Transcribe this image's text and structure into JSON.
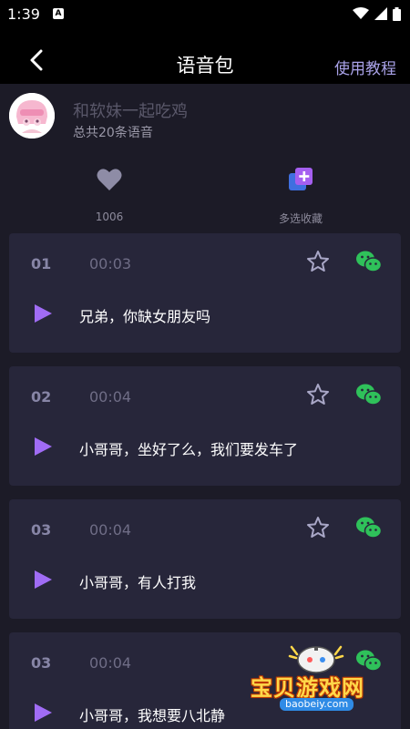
{
  "status_bar": {
    "time": "1:39",
    "notification_letter": "A"
  },
  "header": {
    "title": "语音包",
    "tutorial_label": "使用教程"
  },
  "profile": {
    "name": "和软妹一起吃鸡",
    "count_text": "总共20条语音"
  },
  "actions": {
    "like_count": "1006",
    "multi_select_label": "多选收藏"
  },
  "clips": [
    {
      "index": "01",
      "duration": "00:03",
      "text": "兄弟，你缺女朋友吗"
    },
    {
      "index": "02",
      "duration": "00:04",
      "text": "小哥哥，坐好了么，我们要发车了"
    },
    {
      "index": "03",
      "duration": "00:04",
      "text": "小哥哥，有人打我"
    },
    {
      "index": "03",
      "duration": "00:04",
      "text": "小哥哥，我想要八北静"
    }
  ],
  "watermark": {
    "title": "宝贝游戏网",
    "url": "baobeiy.com"
  },
  "colors": {
    "background": "#1c1b27",
    "card": "#27263a",
    "accent_purple": "#a06cf5",
    "wechat_green": "#2fc15a",
    "link": "#a9a2e8"
  },
  "icons": [
    "back-chevron-icon",
    "heart-icon",
    "multi-select-icon",
    "star-icon",
    "wechat-icon",
    "play-icon"
  ]
}
